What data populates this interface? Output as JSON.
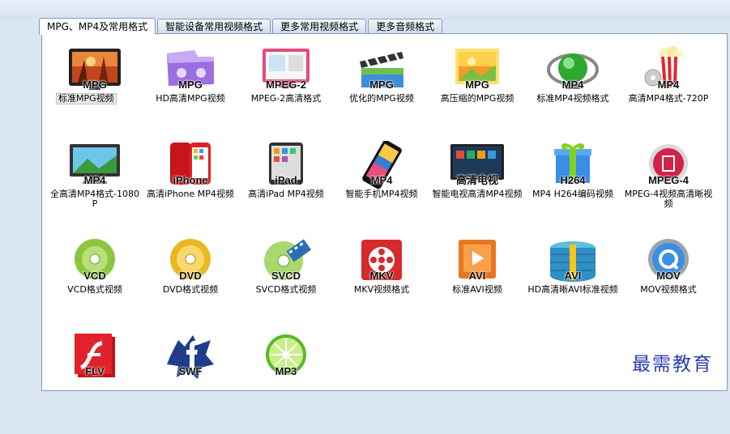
{
  "tabs": [
    {
      "label": "MPG、MP4及常用格式",
      "active": true
    },
    {
      "label": "智能设备常用视频格式",
      "active": false
    },
    {
      "label": "更多常用视频格式",
      "active": false
    },
    {
      "label": "更多音频格式",
      "active": false
    }
  ],
  "formats": [
    {
      "badge": "MPG",
      "label": "标准MPG视频",
      "icon": "landscape-tv-icon"
    },
    {
      "badge": "MPG",
      "label": "HD高清MPG视频",
      "icon": "purple-gamepad-icon"
    },
    {
      "badge": "MPEG-2",
      "label": "MPEG-2高清格式",
      "icon": "monitor-icon"
    },
    {
      "badge": "MPG",
      "label": "优化的MPG视频",
      "icon": "film-clapper-icon"
    },
    {
      "badge": "MPG",
      "label": "高压缩的MPG视频",
      "icon": "picture-frame-icon"
    },
    {
      "badge": "MP4",
      "label": "标准MP4视频格式",
      "icon": "green-globe-icon"
    },
    {
      "badge": "MP4",
      "label": "高清MP4格式-720P",
      "icon": "popcorn-icon"
    },
    {
      "badge": "MP4",
      "label": "全高清MP4格式-1080P",
      "icon": "desktop-monitor-icon"
    },
    {
      "badge": "iPhone",
      "label": "高清iPhone MP4视频",
      "icon": "iphone-icon"
    },
    {
      "badge": "iPad",
      "label": "高清iPad MP4视频",
      "icon": "ipad-icon"
    },
    {
      "badge": "MP4",
      "label": "智能手机MP4视频",
      "icon": "smartphone-icon"
    },
    {
      "badge": "高清电视",
      "label": "智能电视高清MP4视频",
      "icon": "smart-tv-icon"
    },
    {
      "badge": "H264",
      "label": "MP4 H264编码视频",
      "icon": "gift-box-icon"
    },
    {
      "badge": "MPEG-4",
      "label": "MPEG-4视频高清晰视频",
      "icon": "film-circle-icon"
    },
    {
      "badge": "VCD",
      "label": "VCD格式视频",
      "icon": "green-disc-icon"
    },
    {
      "badge": "DVD",
      "label": "DVD格式视频",
      "icon": "gold-disc-icon"
    },
    {
      "badge": "SVCD",
      "label": "SVCD格式视频",
      "icon": "disc-film-icon"
    },
    {
      "badge": "MKV",
      "label": "MKV视频格式",
      "icon": "film-reel-icon"
    },
    {
      "badge": "AVI",
      "label": "标准AVI视频",
      "icon": "play-box-icon"
    },
    {
      "badge": "AVI",
      "label": "HD高清晰AVI标准视频",
      "icon": "blue-gift-box-icon"
    },
    {
      "badge": "MOV",
      "label": "MOV视频格式",
      "icon": "quicktime-icon"
    },
    {
      "badge": "FLV",
      "label": "",
      "icon": "flash-icon"
    },
    {
      "badge": "SWF",
      "label": "",
      "icon": "facebook-splash-icon"
    },
    {
      "badge": "MP3",
      "label": "",
      "icon": "lime-icon"
    }
  ],
  "watermark": "最需教育"
}
